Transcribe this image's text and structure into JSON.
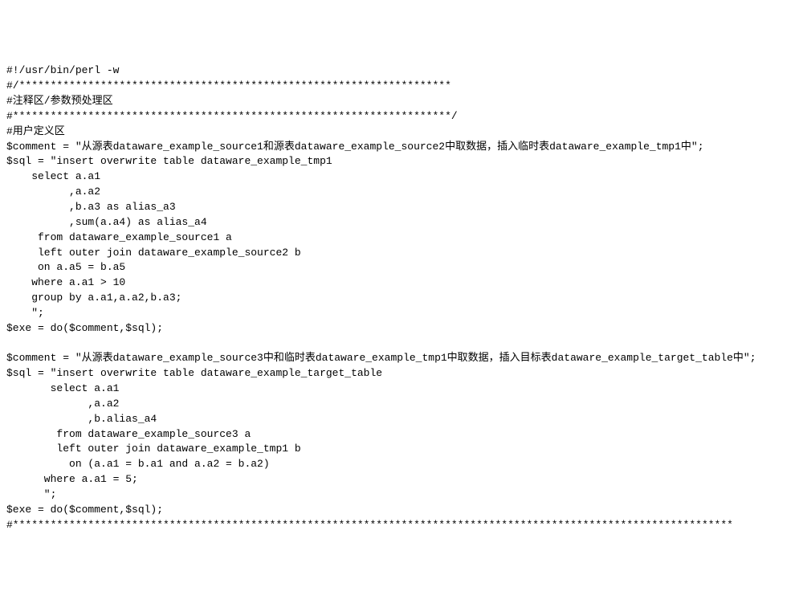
{
  "lines": [
    "#!/usr/bin/perl -w",
    "#/*********************************************************************",
    "#注释区/参数预处理区",
    "#**********************************************************************/",
    "#用户定义区",
    "$comment = \"从源表dataware_example_source1和源表dataware_example_source2中取数据，插入临时表dataware_example_tmp1中\";",
    "$sql = \"insert overwrite table dataware_example_tmp1",
    "    select a.a1",
    "          ,a.a2",
    "          ,b.a3 as alias_a3",
    "          ,sum(a.a4) as alias_a4",
    "     from dataware_example_source1 a",
    "     left outer join dataware_example_source2 b",
    "     on a.a5 = b.a5",
    "    where a.a1 > 10",
    "    group by a.a1,a.a2,b.a3;",
    "    \";",
    "$exe = do($comment,$sql);",
    "",
    "$comment = \"从源表dataware_example_source3中和临时表dataware_example_tmp1中取数据，插入目标表dataware_example_target_table中\";",
    "$sql = \"insert overwrite table dataware_example_target_table",
    "       select a.a1",
    "             ,a.a2",
    "             ,b.alias_a4",
    "        from dataware_example_source3 a",
    "        left outer join dataware_example_tmp1 b",
    "          on (a.a1 = b.a1 and a.a2 = b.a2)",
    "      where a.a1 = 5;",
    "      \";",
    "$exe = do($comment,$sql);",
    "#*******************************************************************************************************************"
  ]
}
